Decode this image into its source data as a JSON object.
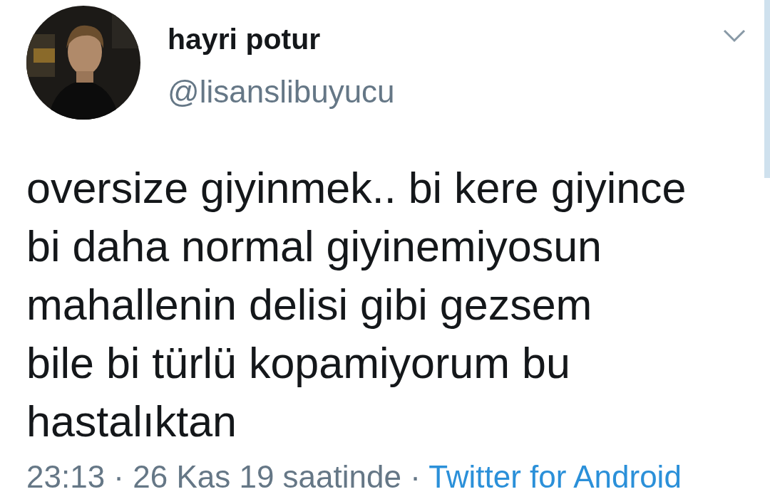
{
  "author": {
    "name": "hayri potur",
    "handle": "@lisanslibuyucu"
  },
  "tweet": {
    "text": "oversize giyinmek.. bi kere giyince\nbi daha normal giyinemiyosun\nmahallenin delisi gibi gezsem\nbile bi türlü kopamiyorum bu\nhastalıktan"
  },
  "meta": {
    "time": "23:13 · 26 Kas 19 saatinde · ",
    "source": "Twitter for Android"
  }
}
